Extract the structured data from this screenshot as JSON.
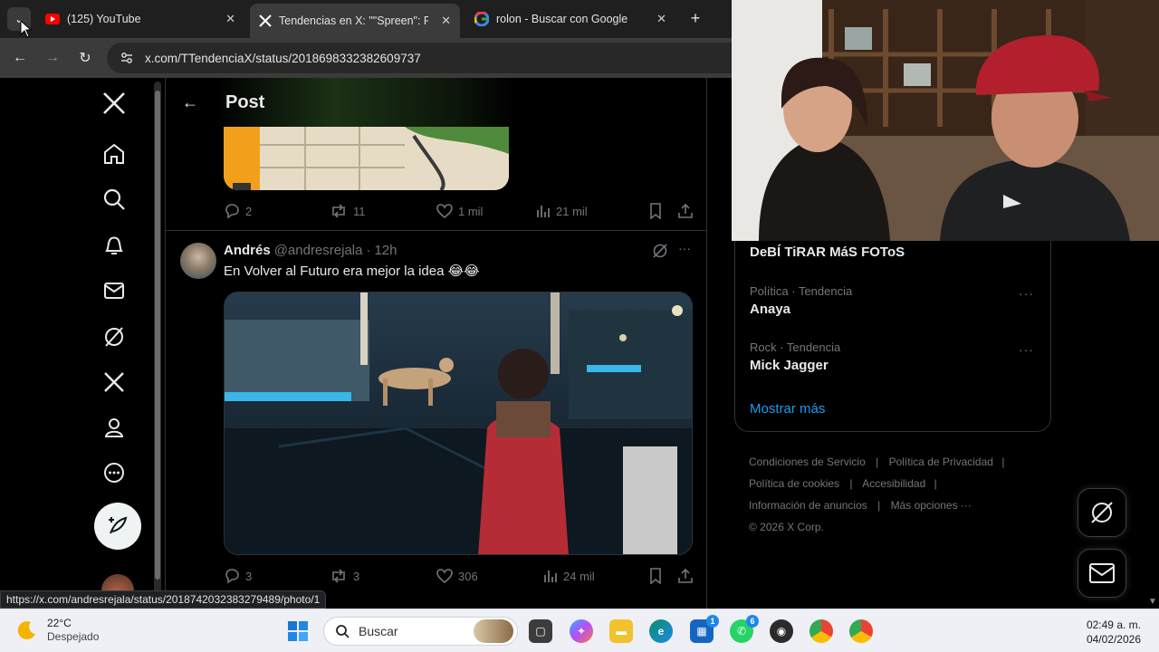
{
  "browser": {
    "tabs": [
      {
        "label": "(125) YouTube",
        "icon": "youtube-icon",
        "active": false
      },
      {
        "label": "Tendencias en X: \"\"Spreen\": Por",
        "icon": "x-logo-icon",
        "active": true
      },
      {
        "label": "rolon - Buscar con Google",
        "icon": "google-icon",
        "active": false
      }
    ],
    "url": "x.com/TTendenciaX/status/2018698332382609737",
    "status_url": "https://x.com/andresrejala/status/2018742032383279489/photo/1"
  },
  "x": {
    "header_title": "Post",
    "nav_icons": [
      "x-logo-icon",
      "home-icon",
      "search-icon",
      "notifications-icon",
      "messages-icon",
      "grok-icon",
      "premium-x-icon",
      "profile-icon",
      "more-icon"
    ],
    "prev_tweet_actions": {
      "replies": "2",
      "reposts": "11",
      "likes": "1 mil",
      "views": "21 mil"
    },
    "tweet": {
      "name": "Andrés",
      "handle": "@andresrejala",
      "separator": "·",
      "time": "12h",
      "text": "En Volver al Futuro  era mejor la idea 😂😂",
      "actions": {
        "replies": "3",
        "reposts": "3",
        "likes": "306",
        "views": "24 mil"
      }
    }
  },
  "sidebar": {
    "trend_top": "DeBÍ TiRAR MáS FOToS",
    "trends": [
      {
        "meta": "Política · Tendencia",
        "name": "Anaya"
      },
      {
        "meta": "Rock · Tendencia",
        "name": "Mick Jagger"
      }
    ],
    "show_more": "Mostrar más",
    "footer": {
      "terms": "Condiciones de Servicio",
      "privacy": "Política de Privacidad",
      "cookies": "Política de cookies",
      "accessibility": "Accesibilidad",
      "ads": "Información de anuncios",
      "more": "Más opciones ···",
      "copyright": "© 2026 X Corp."
    }
  },
  "taskbar": {
    "weather_temp": "22°C",
    "weather_desc": "Despejado",
    "search_placeholder": "Buscar",
    "time": "02:49 a. m.",
    "date": "04/02/2026",
    "badges": {
      "store": "1",
      "whatsapp": "6"
    }
  },
  "colors": {
    "accent": "#1d9bf0",
    "link_blue": "#1d9bf0"
  }
}
